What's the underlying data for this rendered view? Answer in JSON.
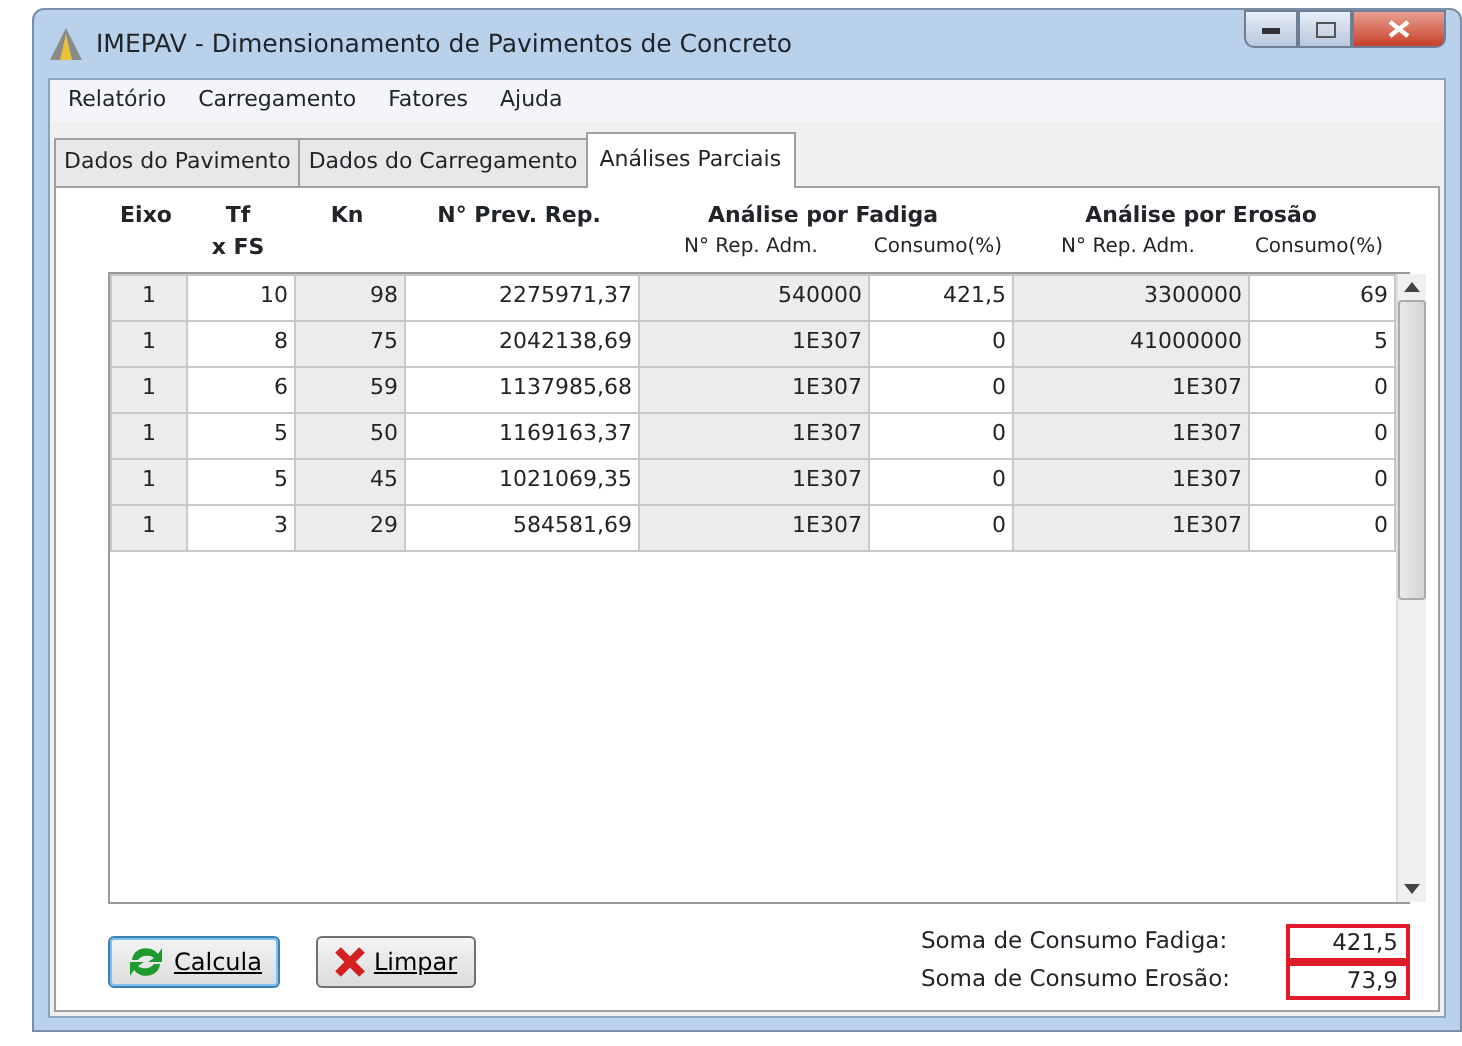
{
  "window": {
    "title": "IMEPAV - Dimensionamento  de Pavimentos de Concreto"
  },
  "menu": [
    "Relatório",
    "Carregamento",
    "Fatores",
    "Ajuda"
  ],
  "tabs": [
    {
      "label": "Dados do Pavimento",
      "selected": false
    },
    {
      "label": "Dados do Carregamento",
      "selected": false
    },
    {
      "label": "Análises Parciais",
      "selected": true
    }
  ],
  "header": {
    "columns": [
      {
        "line1": "Eixo"
      },
      {
        "line1": "Tf",
        "line2": "x FS"
      },
      {
        "line1": "Kn"
      },
      {
        "line1": "N° Prev. Rep."
      }
    ],
    "groups": [
      {
        "title": "Análise por Fadiga",
        "sub": [
          "N° Rep. Adm.",
          "Consumo(%)"
        ]
      },
      {
        "title": "Análise por Erosão",
        "sub": [
          "N° Rep. Adm.",
          "Consumo(%)"
        ]
      }
    ]
  },
  "table": {
    "shaded": [
      true,
      false,
      true,
      false,
      true,
      false,
      true,
      false
    ],
    "rows": [
      [
        "1",
        "10",
        "98",
        "2275971,37",
        "540000",
        "421,5",
        "3300000",
        "69"
      ],
      [
        "1",
        "8",
        "75",
        "2042138,69",
        "1E307",
        "0",
        "41000000",
        "5"
      ],
      [
        "1",
        "6",
        "59",
        "1137985,68",
        "1E307",
        "0",
        "1E307",
        "0"
      ],
      [
        "1",
        "5",
        "50",
        "1169163,37",
        "1E307",
        "0",
        "1E307",
        "0"
      ],
      [
        "1",
        "5",
        "45",
        "1021069,35",
        "1E307",
        "0",
        "1E307",
        "0"
      ],
      [
        "1",
        "3",
        "29",
        "584581,69",
        "1E307",
        "0",
        "1E307",
        "0"
      ]
    ]
  },
  "buttons": [
    {
      "label": "Calcula",
      "kind": "refresh",
      "focused": true
    },
    {
      "label": "Limpar",
      "kind": "clear",
      "focused": false
    }
  ],
  "totals": [
    {
      "label": "Soma de Consumo Fadiga:",
      "value": "421,5",
      "highlighted": true
    },
    {
      "label": "Soma de Consumo Erosão:",
      "value": "73,9",
      "highlighted": true
    }
  ]
}
